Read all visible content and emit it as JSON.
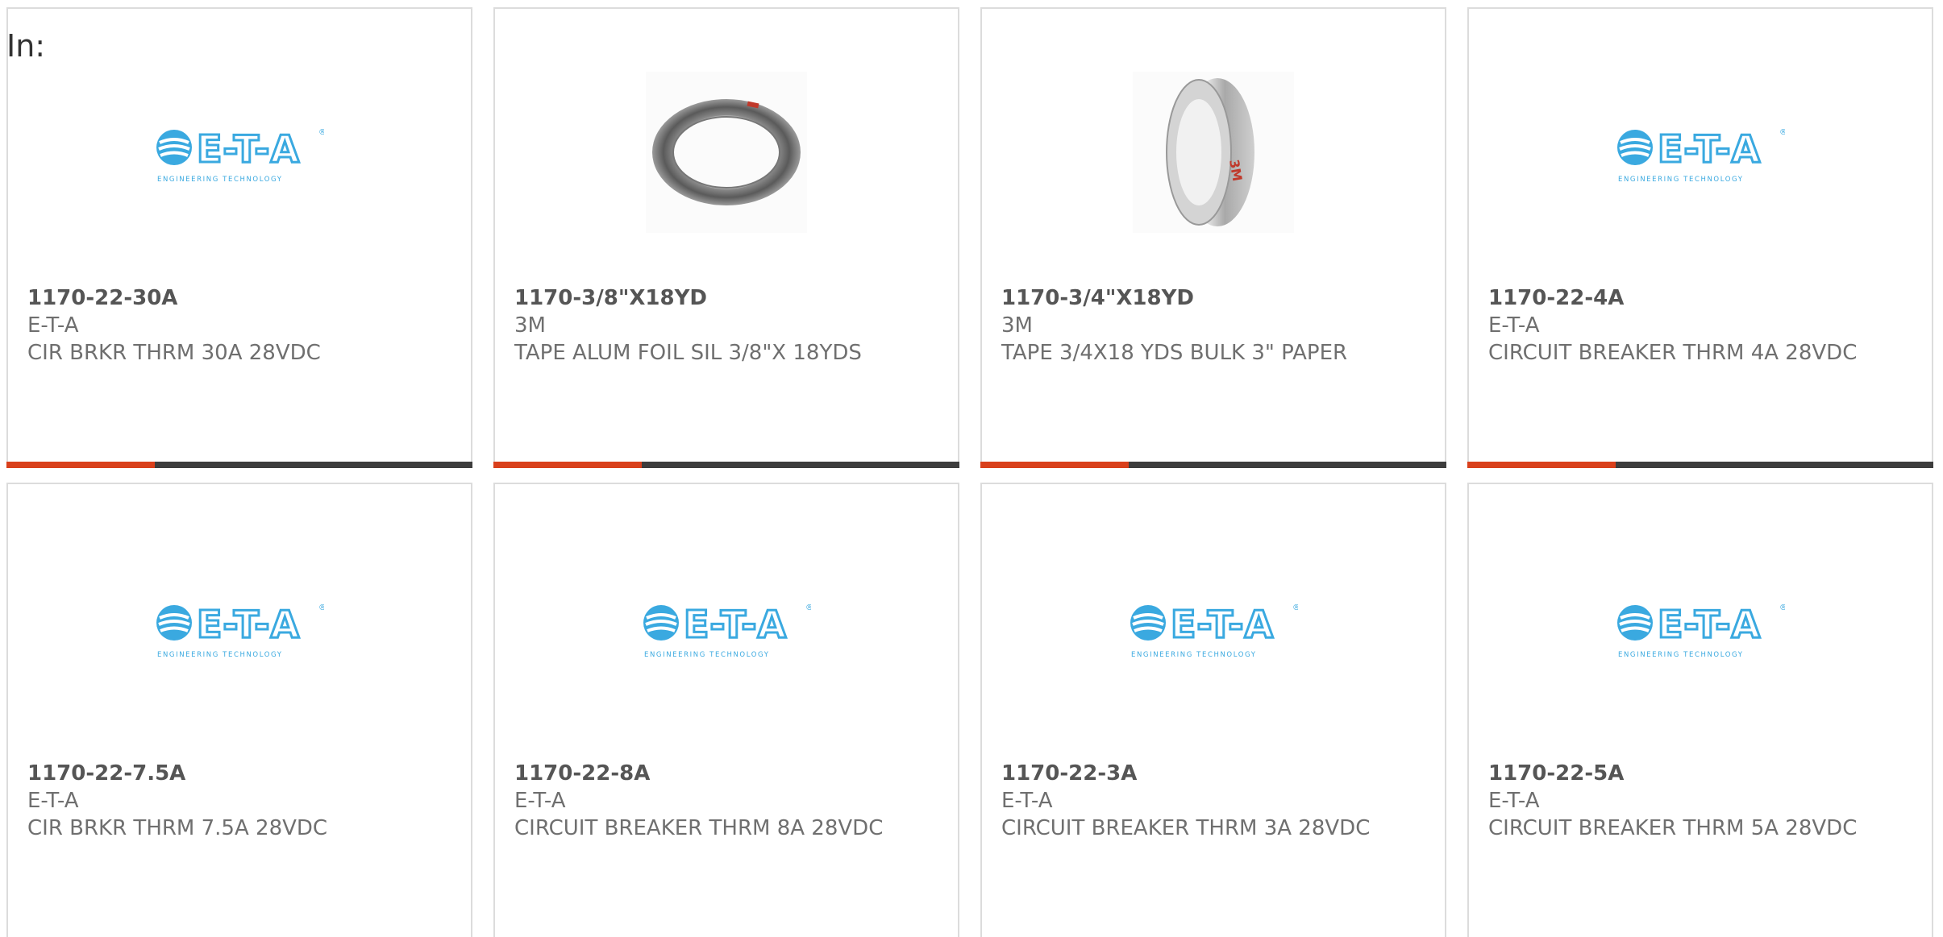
{
  "filter_label": "In:",
  "colors": {
    "accent": "#d9401c",
    "bar_dark": "#3d3d3d",
    "eta_blue": "#3aa9e0"
  },
  "products": [
    {
      "part": "1170-22-30A",
      "manufacturer": "E-T-A",
      "description": "CIR BRKR THRM 30A 28VDC",
      "image": "eta-logo"
    },
    {
      "part": "1170-3/8\"X18YD",
      "manufacturer": "3M",
      "description": "TAPE ALUM FOIL SIL 3/8\"X 18YDS",
      "image": "tape-roll-narrow"
    },
    {
      "part": "1170-3/4\"X18YD",
      "manufacturer": "3M",
      "description": "TAPE 3/4X18 YDS BULK 3\" PAPER",
      "image": "tape-roll-wide"
    },
    {
      "part": "1170-22-4A",
      "manufacturer": "E-T-A",
      "description": "CIRCUIT BREAKER THRM 4A 28VDC",
      "image": "eta-logo"
    },
    {
      "part": "1170-22-7.5A",
      "manufacturer": "E-T-A",
      "description": "CIR BRKR THRM 7.5A 28VDC",
      "image": "eta-logo"
    },
    {
      "part": "1170-22-8A",
      "manufacturer": "E-T-A",
      "description": "CIRCUIT BREAKER THRM 8A 28VDC",
      "image": "eta-logo"
    },
    {
      "part": "1170-22-3A",
      "manufacturer": "E-T-A",
      "description": "CIRCUIT BREAKER THRM 3A 28VDC",
      "image": "eta-logo"
    },
    {
      "part": "1170-22-5A",
      "manufacturer": "E-T-A",
      "description": "CIRCUIT BREAKER THRM 5A 28VDC",
      "image": "eta-logo"
    }
  ],
  "eta_logo": {
    "wordmark": "E-T-A",
    "tagline": "ENGINEERING TECHNOLOGY"
  },
  "tape_brand": "3M"
}
